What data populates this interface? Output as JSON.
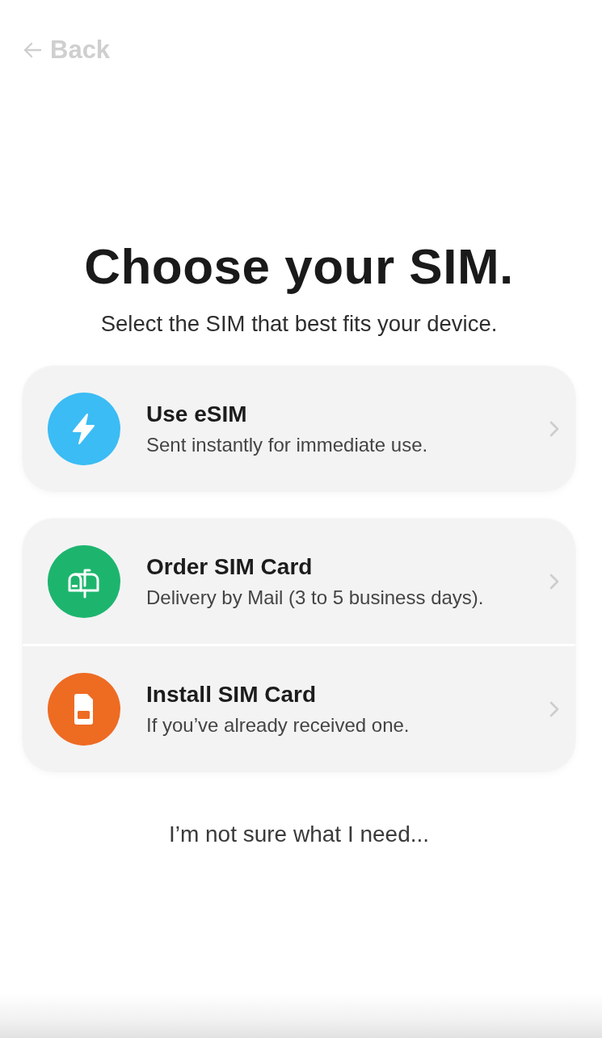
{
  "back": {
    "label": "Back"
  },
  "title": "Choose your SIM.",
  "subtitle": "Select the SIM that best fits your device.",
  "option_groups": [
    {
      "options": [
        {
          "kind": "esim",
          "title": "Use eSIM",
          "description": "Sent instantly for immediate use.",
          "color": "#3bbcf4"
        }
      ]
    },
    {
      "options": [
        {
          "kind": "mail",
          "title": "Order SIM Card",
          "description": "Delivery by Mail (3 to 5 business days).",
          "color": "#1db56e"
        },
        {
          "kind": "sim",
          "title": "Install SIM Card",
          "description": "If you’ve already received one.",
          "color": "#ee6b22"
        }
      ]
    }
  ],
  "help_link": "I’m not sure what I need..."
}
